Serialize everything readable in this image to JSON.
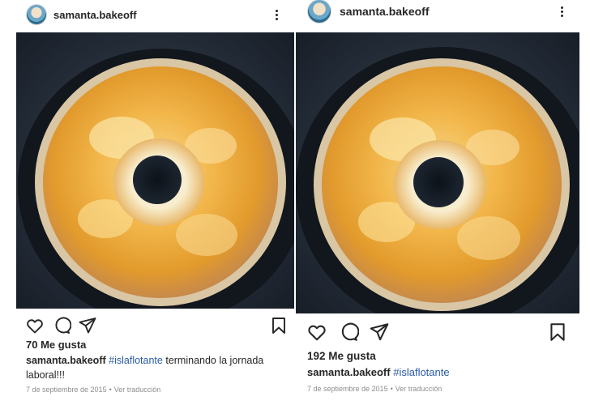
{
  "posts": [
    {
      "username": "samanta.bakeoff",
      "likes": "70 Me gusta",
      "caption_user": "samanta.bakeoff",
      "hashtag": "#islaflotante",
      "caption_text": "terminando la jornada laboral!!!",
      "date": "7 de septiembre de 2015",
      "translate": "Ver traducción"
    },
    {
      "username": "samanta.bakeoff",
      "likes": "192 Me gusta",
      "caption_user": "samanta.bakeoff",
      "hashtag": "#islaflotante",
      "date": "7 de septiembre de 2015",
      "translate": "Ver traducción"
    }
  ],
  "icons": {
    "more": "more-options-icon",
    "like": "heart-icon",
    "comment": "comment-icon",
    "share": "share-icon",
    "save": "bookmark-icon"
  },
  "colors": {
    "hashtag": "#2a5aa8",
    "text": "#262626",
    "meta": "#8e8e8e"
  }
}
